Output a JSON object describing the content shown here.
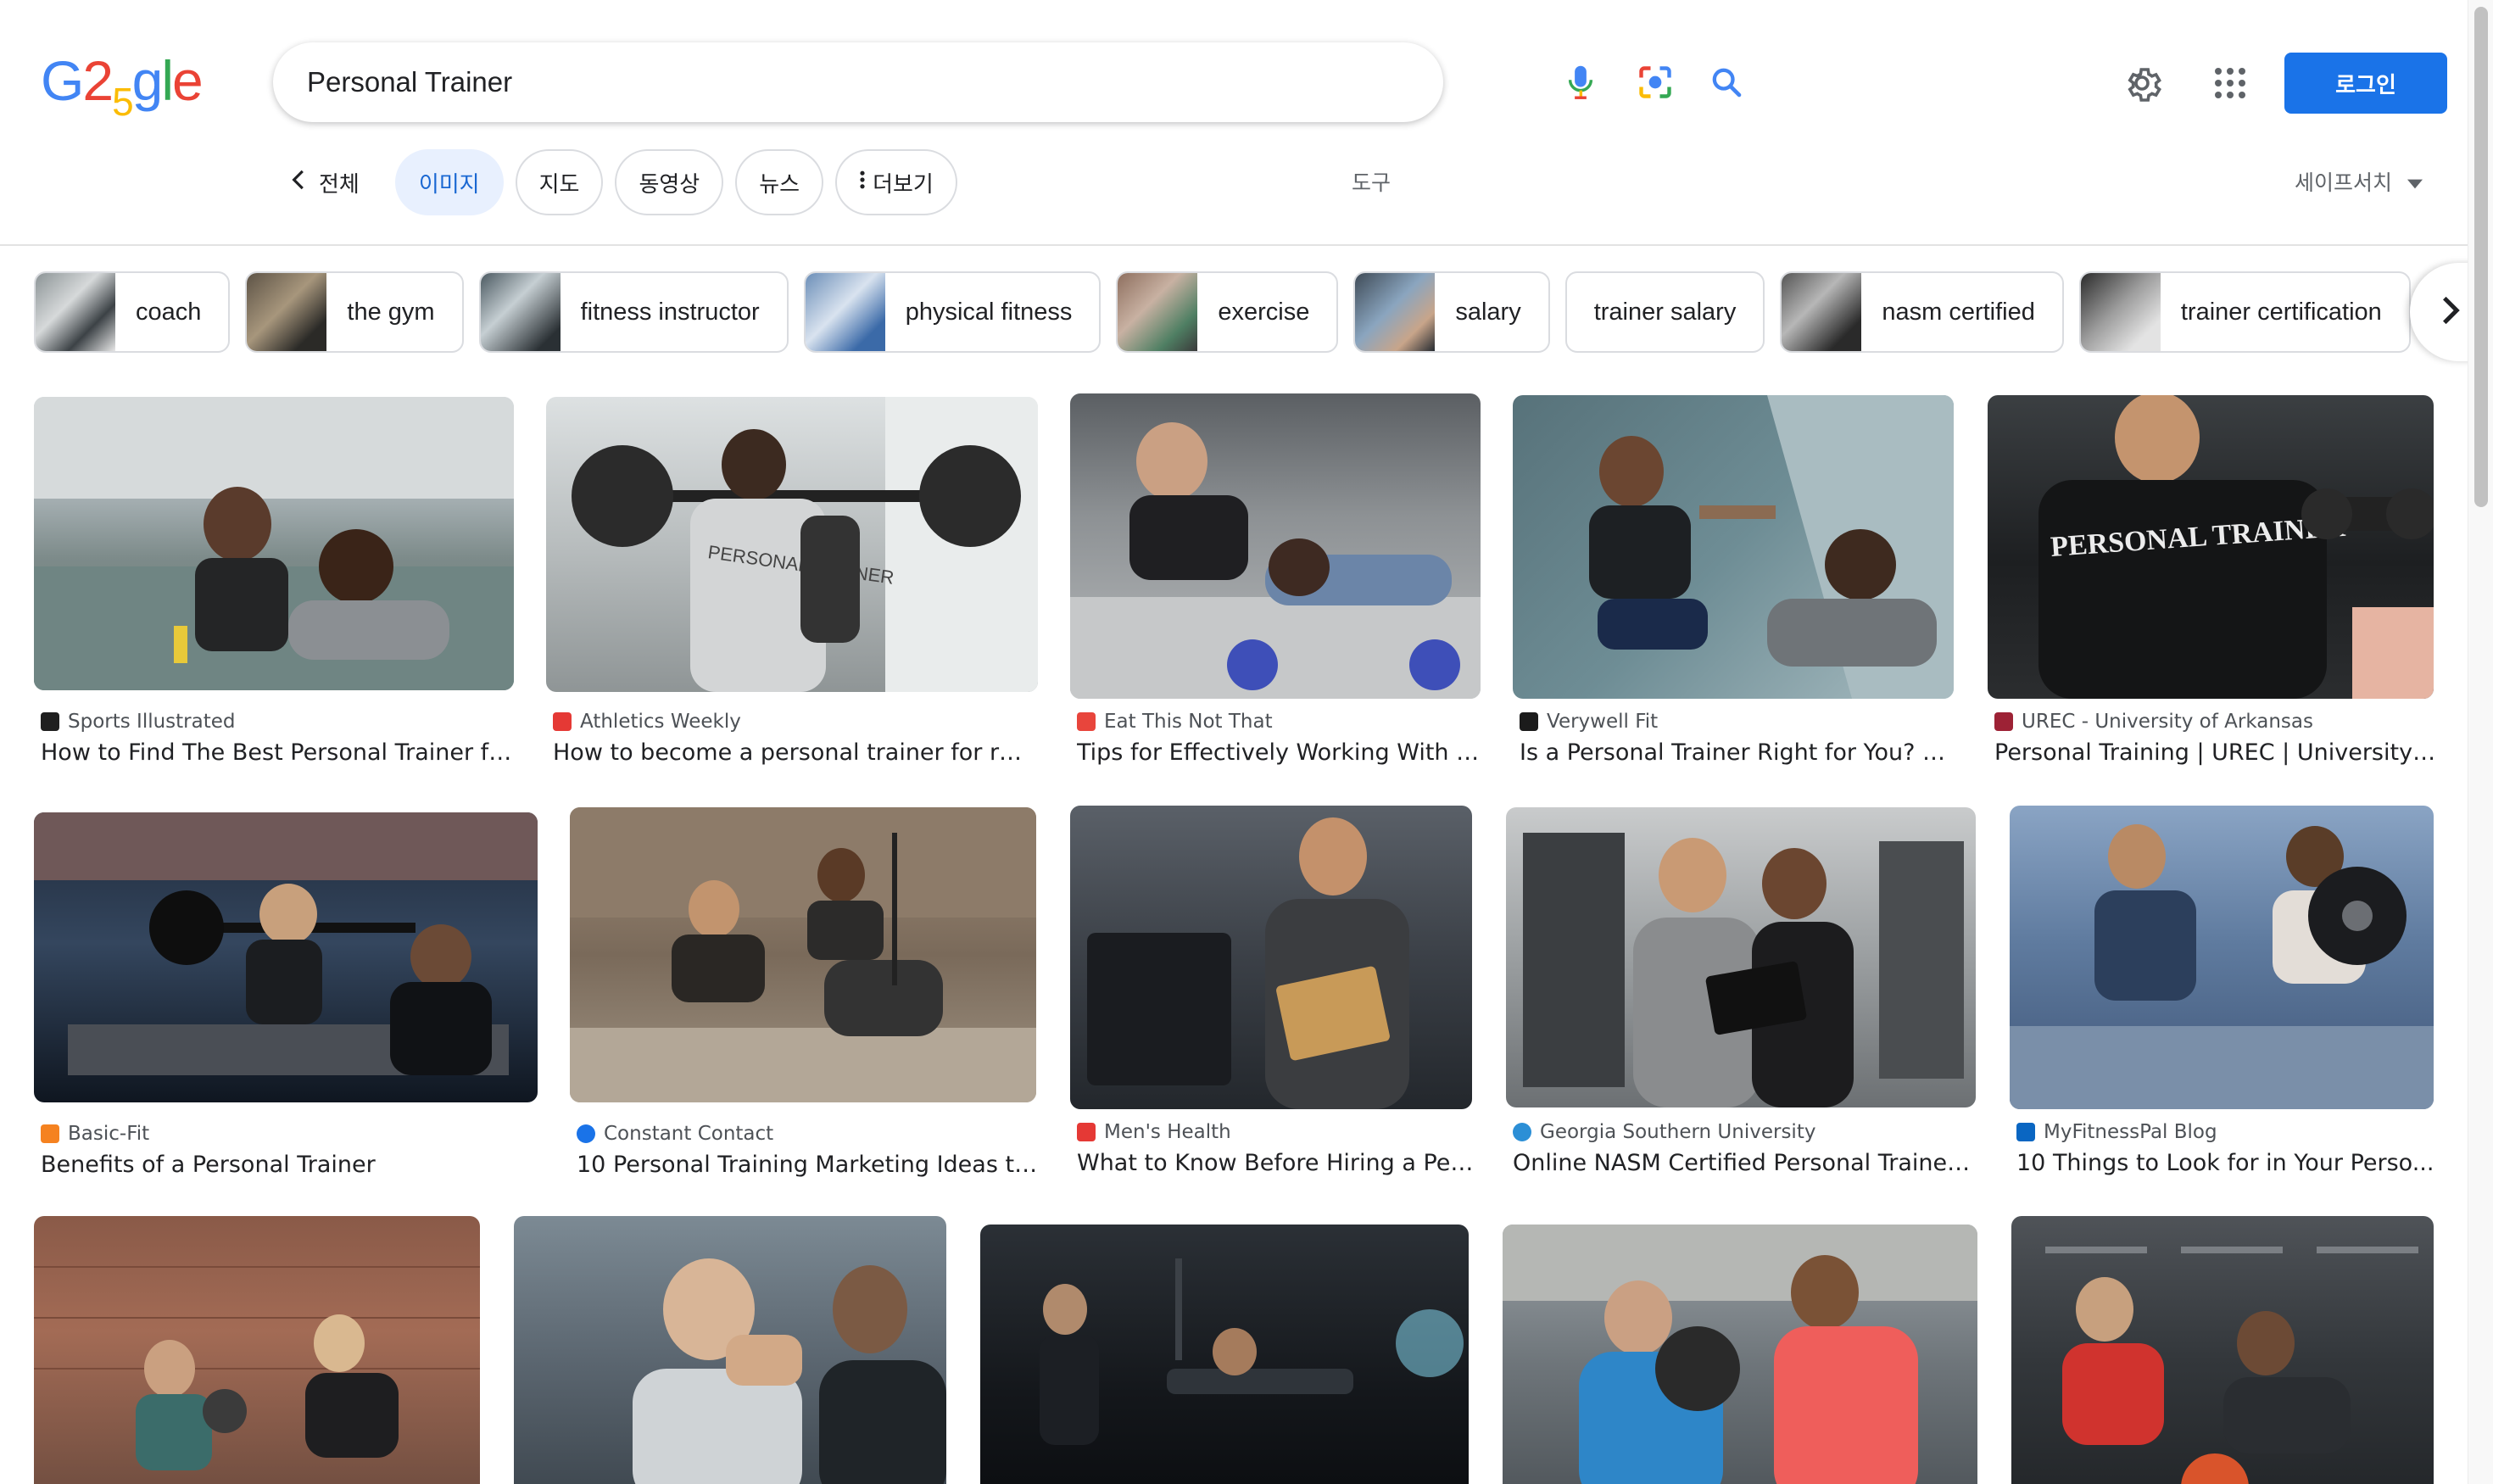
{
  "logo": {
    "g1": "G",
    "num": "2",
    "num_sub": "5",
    "rest_g": "g",
    "rest_l": "l",
    "rest_e": "e"
  },
  "search": {
    "query": "Personal Trainer"
  },
  "icons": {
    "mic": "microphone-icon",
    "lens": "camera-lens-icon",
    "search": "search-icon",
    "settings": "gear-icon",
    "apps": "apps-grid-icon"
  },
  "header": {
    "login_label": "로그인"
  },
  "tabs": {
    "all": "전체",
    "images": "이미지",
    "maps": "지도",
    "videos": "동영상",
    "news": "뉴스",
    "more": "더보기",
    "tools": "도구",
    "safesearch": "세이프서치"
  },
  "chips": [
    {
      "label": "coach"
    },
    {
      "label": "the gym"
    },
    {
      "label": "fitness instructor"
    },
    {
      "label": "physical fitness"
    },
    {
      "label": "exercise"
    },
    {
      "label": "salary"
    },
    {
      "label": "trainer salary"
    },
    {
      "label": "nasm certified"
    },
    {
      "label": "trainer certification"
    }
  ],
  "results": [
    {
      "source": "Sports Illustrated",
      "title": "How to Find The Best Personal Trainer fo..."
    },
    {
      "source": "Athletics Weekly",
      "title": "How to become a personal trainer for runn..."
    },
    {
      "source": "Eat This Not That",
      "title": "Tips for Effectively Working With a ..."
    },
    {
      "source": "Verywell Fit",
      "title": "Is a Personal Trainer Right for You? 1..."
    },
    {
      "source": "UREC - University of Arkansas",
      "title": "Personal Training | UREC | University o..."
    },
    {
      "source": "Basic-Fit",
      "title": "Benefits of a Personal Trainer"
    },
    {
      "source": "Constant Contact",
      "title": "10 Personal Training Marketing Ideas to..."
    },
    {
      "source": "Men's Health",
      "title": "What to Know Before Hiring a Per..."
    },
    {
      "source": "Georgia Southern University",
      "title": "Online NASM Certified Personal Trainer ..."
    },
    {
      "source": "MyFitnessPal Blog",
      "title": "10 Things to Look for in Your Perso..."
    },
    {
      "source": "",
      "title": ""
    },
    {
      "source": "",
      "title": ""
    },
    {
      "source": "",
      "title": ""
    },
    {
      "source": "",
      "title": ""
    },
    {
      "source": "",
      "title": ""
    }
  ],
  "image_text": {
    "shirt_1": "PERSONAL TRAINER",
    "shirt_2": "PERSONAL TRAINER"
  },
  "colors": {
    "accent": "#1a73e8",
    "active_tab_bg": "#e8f0fe",
    "active_tab_text": "#1967d2"
  }
}
